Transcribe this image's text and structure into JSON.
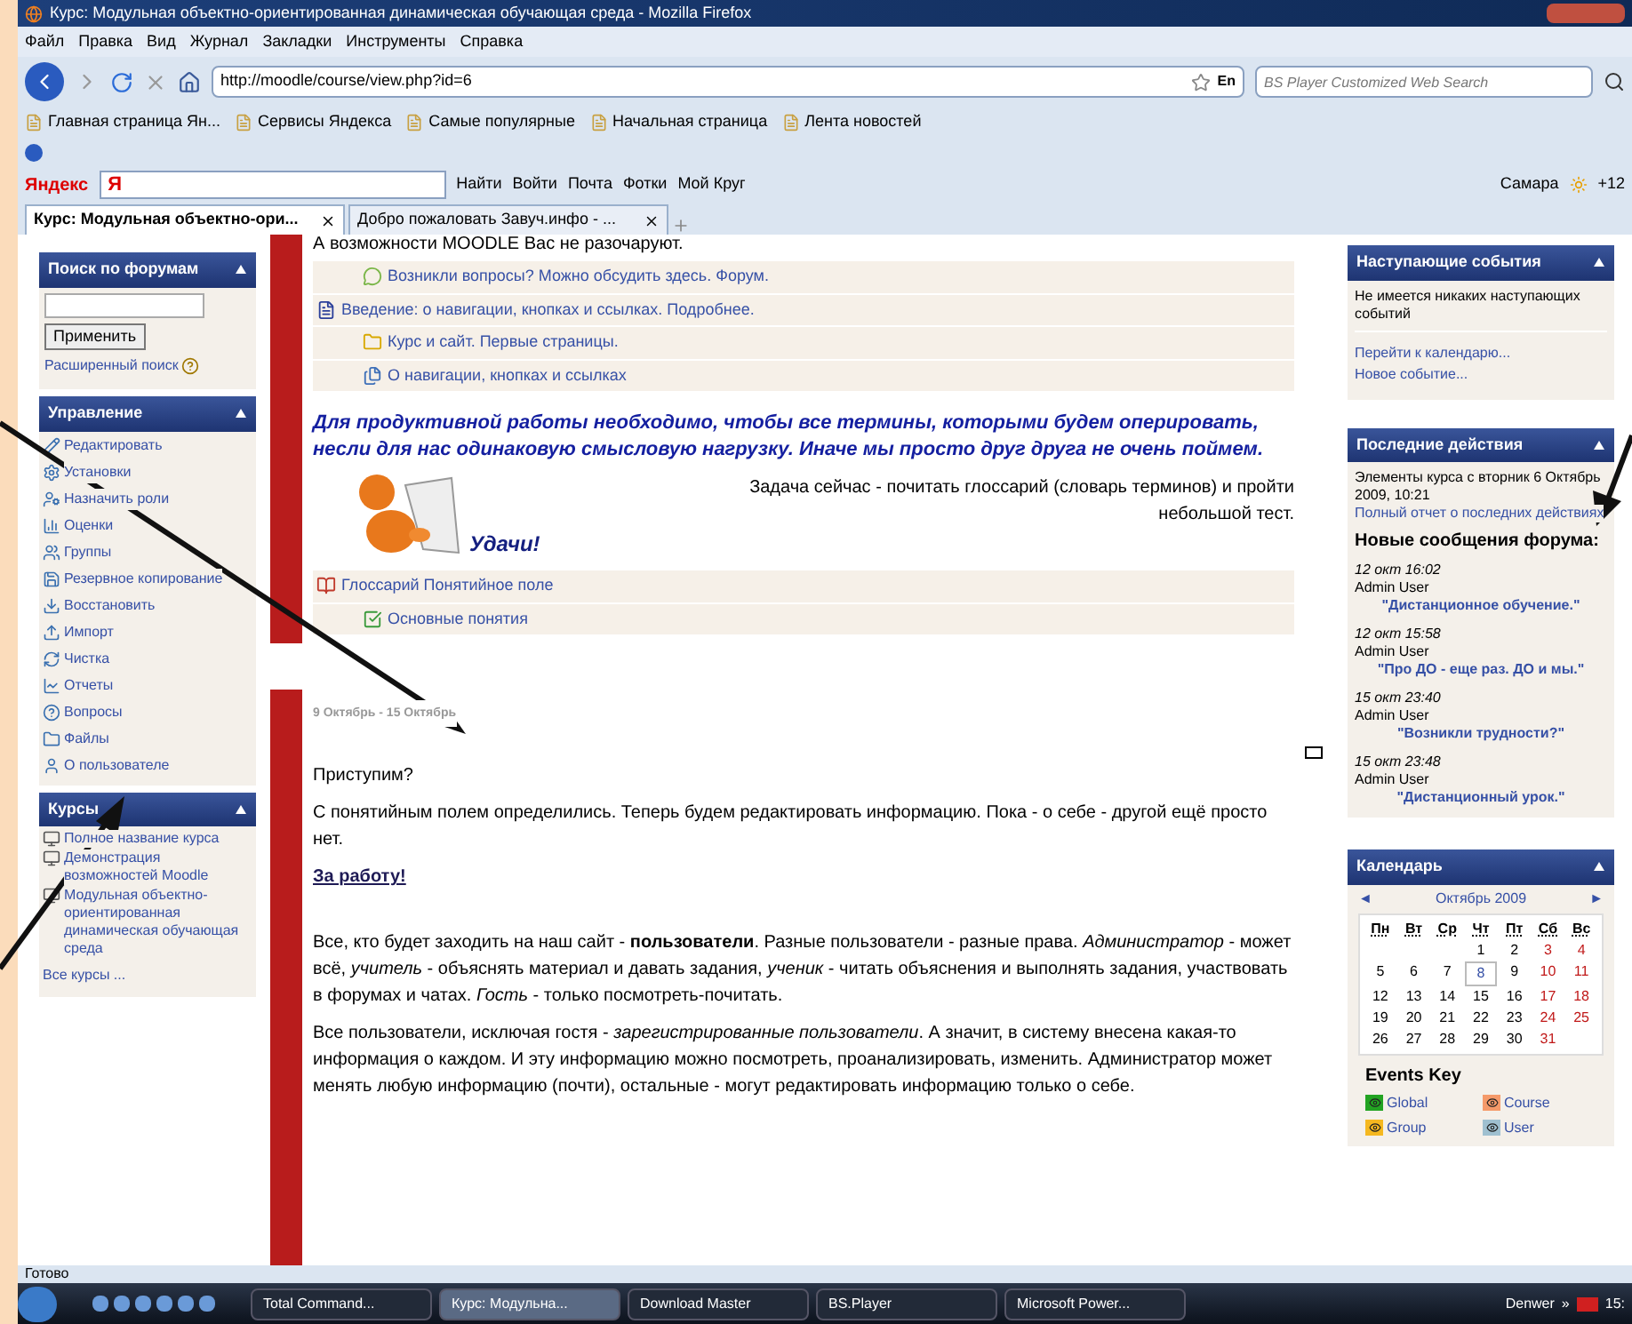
{
  "window": {
    "title": "Курс: Модульная объектно-ориентированная динамическая обучающая среда - Mozilla Firefox"
  },
  "menu": [
    "Файл",
    "Правка",
    "Вид",
    "Журнал",
    "Закладки",
    "Инструменты",
    "Справка"
  ],
  "nav": {
    "url": "http://moodle/course/view.php?id=6",
    "lang": "En",
    "search_placeholder": "BS Player Customized Web Search"
  },
  "bookmarks": [
    "Главная страница Ян...",
    "Сервисы Яндекса",
    "Самые популярные",
    "Начальная страница",
    "Лента новостей"
  ],
  "yandex_bar": {
    "logo": "Яндекс",
    "field_logo": "Я",
    "find": "Найти",
    "items": [
      "Войти",
      "Почта",
      "Фотки",
      "Мой Круг"
    ],
    "city": "Самара",
    "temp": "+12"
  },
  "tabs": [
    {
      "label": "Курс: Модульная объектно-ори...",
      "selected": true
    },
    {
      "label": "Добро пожаловать Завуч.инфо - ...",
      "selected": false
    }
  ],
  "left": {
    "search_block": {
      "title": "Поиск по форумам",
      "button": "Применить",
      "advanced": "Расширенный поиск"
    },
    "admin_block": {
      "title": "Управление",
      "items": [
        "Редактировать",
        "Установки",
        "Назначить роли",
        "Оценки",
        "Группы",
        "Резервное копирование",
        "Восстановить",
        "Импорт",
        "Чистка",
        "Отчеты",
        "Вопросы",
        "Файлы",
        "О пользователе"
      ]
    },
    "courses_block": {
      "title": "Курсы",
      "items": [
        "Полное название курса",
        "Демонстрация возможностей Moodle",
        "Модульная объектно-ориентированная динамическая обучающая среда"
      ],
      "all": "Все курсы ..."
    }
  },
  "section1": {
    "top_text": "А возможности MOODLE Вас не разочаруют.",
    "rows": [
      {
        "kind": "forum",
        "label": "Возникли вопросы? Можно обсудить здесь. Форум.",
        "indented": true
      },
      {
        "kind": "document",
        "label": "Введение: о навигации, кнопках и ссылках. Подробнее.",
        "indented": false
      },
      {
        "kind": "folder",
        "label": "Курс и сайт. Первые страницы.",
        "indented": true
      },
      {
        "kind": "page",
        "label": "О навигации, кнопках и ссылках",
        "indented": true
      }
    ],
    "highlight": "Для продуктивной работы необходимо, чтобы все термины, которыми будем оперировать, несли для нас одинаковую смысловую нагрузку. Иначе мы просто друг друга не очень поймем.",
    "task": "Задача сейчас - почитать глоссарий (словарь терминов) и пройти небольшой тест.",
    "luck": "Удачи!",
    "rows2": [
      {
        "kind": "glossary",
        "label": "Глоссарий Понятийное поле",
        "indented": false
      },
      {
        "kind": "quiz",
        "label": "Основные понятия",
        "indented": true
      }
    ]
  },
  "section2": {
    "dates": "9 Октябрь - 15 Октябрь",
    "intro": "Приступим?",
    "p1": "С понятийным полем определились. Теперь будем редактировать информацию. Пока - о себе - другой ещё просто нет.",
    "link": "За работу!",
    "p2": "Все, кто будет заходить на наш сайт - **пользователи**. Разные пользователи - разные права. *Администратор* - может всё, *учитель* - объяснять материал и давать задания, *ученик* - читать объяснения и выполнять задания, участвовать в форумах и чатах. *Гость* - только посмотреть-почитать.",
    "p3": "Все пользователи, исключая гостя - *зарегистрированные пользователи*. А значит, в систему внесена какая-то информация о каждом. И эту информацию можно посмотреть, проанализировать, изменить. Администратор может менять любую информацию (почти), остальные - могут редактировать информацию только о себе."
  },
  "right": {
    "events": {
      "title": "Наступающие события",
      "none": "Не имеется никаких наступающих событий",
      "links": [
        "Перейти к календарю...",
        "Новое событие..."
      ]
    },
    "recent": {
      "title": "Последние действия",
      "since": "Элементы курса с вторник 6 Октябрь 2009, 10:21",
      "report": "Полный отчет о последних действиях",
      "heading": "Новые сообщения форума:",
      "posts": [
        {
          "time": "12 окт 16:02",
          "author": "Admin User",
          "title": "\"Дистанционное обучение.\""
        },
        {
          "time": "12 окт 15:58",
          "author": "Admin User",
          "title": "\"Про ДО - еще раз. ДО и мы.\""
        },
        {
          "time": "15 окт 23:40",
          "author": "Admin User",
          "title": "\"Возникли трудности?\""
        },
        {
          "time": "15 окт 23:48",
          "author": "Admin User",
          "title": "\"Дистанционный урок.\""
        }
      ]
    },
    "calendar": {
      "title": "Календарь",
      "prev": "◄",
      "month": "Октябрь 2009",
      "next": "►",
      "weekdays": [
        "Пн",
        "Вт",
        "Ср",
        "Чт",
        "Пт",
        "Сб",
        "Вс"
      ],
      "weeks": [
        [
          {
            "d": "1",
            "today": false
          },
          {
            "d": "2",
            "today": false
          },
          {
            "d": "3",
            "today": false
          },
          {
            "d": "4",
            "today": false
          }
        ],
        [
          {
            "d": "5",
            "today": false
          },
          {
            "d": "6",
            "today": false
          },
          {
            "d": "7",
            "today": false
          },
          {
            "d": "8",
            "today": true
          },
          {
            "d": "9",
            "today": false
          },
          {
            "d": "10",
            "today": false
          },
          {
            "d": "11",
            "today": false
          }
        ],
        [
          {
            "d": "12",
            "today": false
          },
          {
            "d": "13",
            "today": false
          },
          {
            "d": "14",
            "today": false
          },
          {
            "d": "15",
            "today": false
          },
          {
            "d": "16",
            "today": false
          },
          {
            "d": "17",
            "today": false
          },
          {
            "d": "18",
            "today": false
          }
        ],
        [
          {
            "d": "19",
            "today": false
          },
          {
            "d": "20",
            "today": false
          },
          {
            "d": "21",
            "today": false
          },
          {
            "d": "22",
            "today": false
          },
          {
            "d": "23",
            "today": false
          },
          {
            "d": "24",
            "today": false
          },
          {
            "d": "25",
            "today": false
          }
        ],
        [
          {
            "d": "26",
            "today": false
          },
          {
            "d": "27",
            "today": false
          },
          {
            "d": "28",
            "today": false
          },
          {
            "d": "29",
            "today": false
          },
          {
            "d": "30",
            "today": false
          },
          {
            "d": "31",
            "today": false
          }
        ]
      ],
      "key_title": "Events Key",
      "key": [
        {
          "label": "Global",
          "color": "#22a322"
        },
        {
          "label": "Course",
          "color": "#f59a6a"
        },
        {
          "label": "Group",
          "color": "#f5b820"
        },
        {
          "label": "User",
          "color": "#9fc0d0"
        }
      ]
    }
  },
  "status": "Готово",
  "taskbar": {
    "tasks": [
      {
        "label": "Total Command...",
        "selected": false
      },
      {
        "label": "Курс: Модульна...",
        "selected": true
      },
      {
        "label": "Download Master",
        "selected": false
      },
      {
        "label": "BS.Player",
        "selected": false
      },
      {
        "label": "Microsoft Power...",
        "selected": false
      }
    ],
    "tray_label": "Denwer",
    "chevron": "»",
    "time": "15:"
  }
}
